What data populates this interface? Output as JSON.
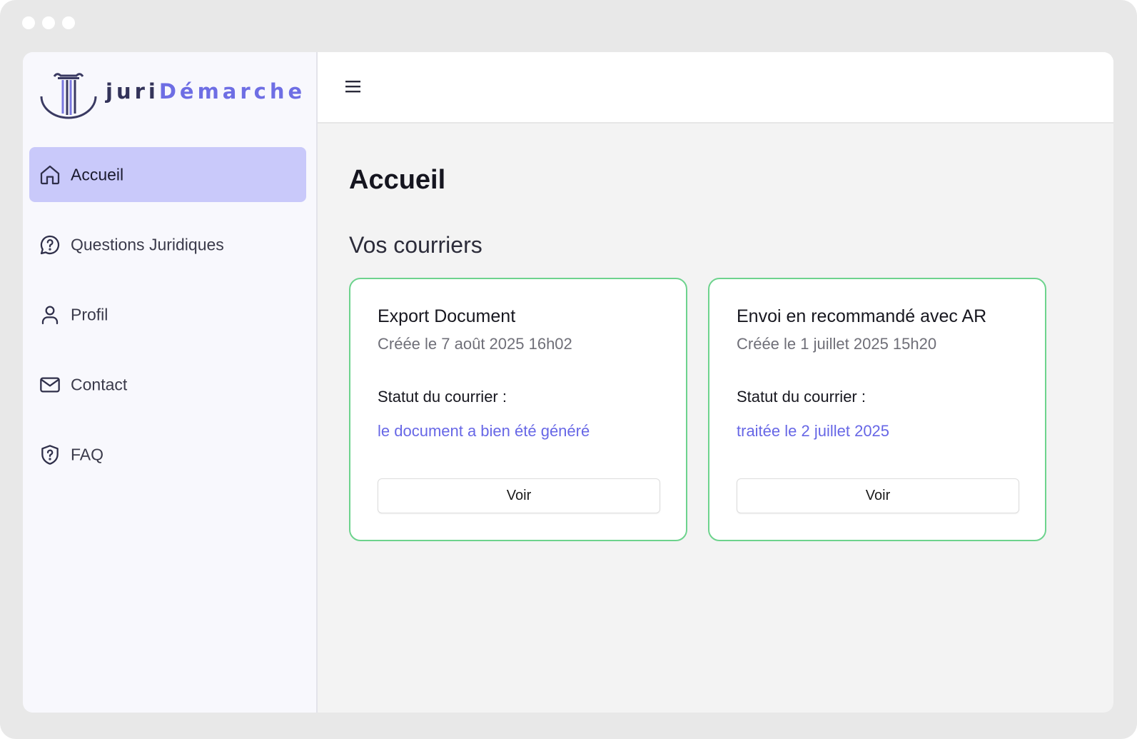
{
  "window_controls": [
    "close",
    "minimize",
    "maximize"
  ],
  "brand": {
    "name_part1": "juri",
    "name_part2": "Démarche",
    "colors": {
      "dark": "#33335a",
      "accent": "#6e6ee4"
    }
  },
  "sidebar": {
    "items": [
      {
        "label": "Accueil",
        "icon": "home-icon",
        "active": true
      },
      {
        "label": "Questions Juridiques",
        "icon": "question-bubble-icon",
        "active": false
      },
      {
        "label": "Profil",
        "icon": "user-icon",
        "active": false
      },
      {
        "label": "Contact",
        "icon": "mail-icon",
        "active": false
      },
      {
        "label": "FAQ",
        "icon": "shield-question-icon",
        "active": false
      }
    ]
  },
  "header": {
    "menu_icon": "hamburger-menu-icon"
  },
  "main": {
    "title": "Accueil",
    "section_title": "Vos courriers",
    "cards": [
      {
        "title": "Export Document",
        "date": "Créée le 7 août 2025 16h02",
        "status_label": "Statut du courrier :",
        "status": "le document a bien été généré",
        "button": "Voir"
      },
      {
        "title": "Envoi en recommandé avec AR",
        "date": "Créée le 1 juillet 2025 15h20",
        "status_label": "Statut du courrier :",
        "status": "traitée le 2 juillet 2025",
        "button": "Voir"
      }
    ]
  },
  "colors": {
    "active_nav_bg": "#c9c9fa",
    "card_border": "#6dd38d",
    "status_text": "#6767e6"
  }
}
